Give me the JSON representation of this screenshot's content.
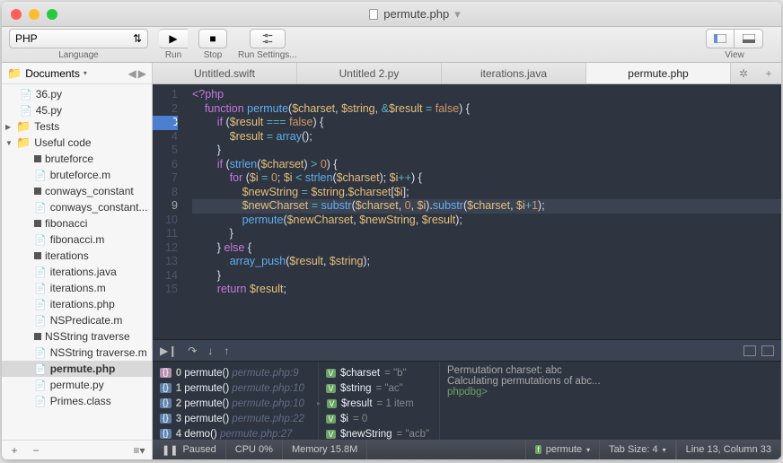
{
  "title": "permute.php",
  "toolbar": {
    "language_label": "Language",
    "language_value": "PHP",
    "run_label": "Run",
    "stop_label": "Stop",
    "settings_label": "Run Settings...",
    "view_label": "View"
  },
  "sidebar": {
    "root": "Documents",
    "folders": [
      {
        "name": "Tests",
        "expanded": false
      },
      {
        "name": "Useful code",
        "expanded": true
      }
    ],
    "root_files": [
      "36.py",
      "45.py"
    ],
    "useful_files": [
      "bruteforce",
      "bruteforce.m",
      "conways_constant",
      "conways_constant...",
      "fibonacci",
      "fibonacci.m",
      "iterations",
      "iterations.java",
      "iterations.m",
      "iterations.php",
      "NSPredicate.m",
      "NSString traverse",
      "NSString traverse.m",
      "permute.php",
      "permute.py",
      "Primes.class"
    ],
    "selected": "permute.php"
  },
  "tabs": [
    "Untitled.swift",
    "Untitled 2.py",
    "iterations.java",
    "permute.php"
  ],
  "active_tab": 3,
  "editor": {
    "first_line": 1,
    "breakpoint_line": 3,
    "current_line": 9,
    "lines_count": 15
  },
  "debug": {
    "stack": [
      {
        "n": 0,
        "fn": "permute()",
        "src": "permute.php:9"
      },
      {
        "n": 1,
        "fn": "permute()",
        "src": "permute.php:10"
      },
      {
        "n": 2,
        "fn": "permute()",
        "src": "permute.php:10"
      },
      {
        "n": 3,
        "fn": "permute()",
        "src": "permute.php:22"
      },
      {
        "n": 4,
        "fn": "demo()",
        "src": "permute.php:27"
      }
    ],
    "vars": [
      {
        "name": "$charset",
        "val": "= \"b\""
      },
      {
        "name": "$string",
        "val": "= \"ac\""
      },
      {
        "name": "$result",
        "val": "= 1 item",
        "exp": true
      },
      {
        "name": "$i",
        "val": "= 0"
      },
      {
        "name": "$newString",
        "val": "= \"acb\""
      }
    ],
    "output": [
      "Permutation charset: abc",
      "Calculating permutations of abc...",
      "phpdbg>"
    ]
  },
  "status": {
    "state": "Paused",
    "cpu": "CPU 0%",
    "mem": "Memory 15.8M",
    "func": "permute",
    "tab_size": "Tab Size: 4",
    "pos": "Line 13, Column 33"
  }
}
